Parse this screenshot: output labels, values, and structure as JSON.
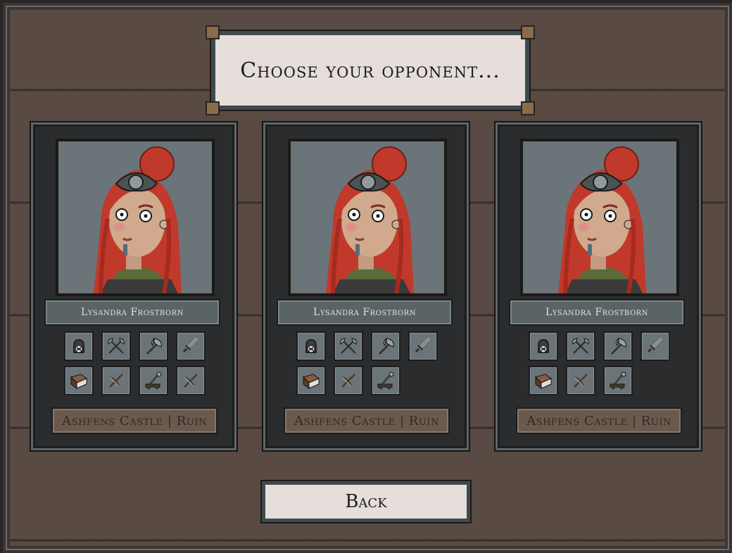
{
  "title": "Choose your opponent...",
  "opponents": [
    {
      "name": "Lysandra Frostborn",
      "location": "Ashfens Castle | Ruin",
      "items": [
        "bell-icon",
        "crossed-axes-icon",
        "battle-axe-icon",
        "sword-icon",
        "book-icon",
        "crossbow-icon",
        "catapult-icon",
        "crossbow-icon"
      ]
    },
    {
      "name": "Lysandra Frostborn",
      "location": "Ashfens Castle | Ruin",
      "items": [
        "bell-icon",
        "crossed-axes-icon",
        "battle-axe-icon",
        "sword-icon",
        "book-icon",
        "crossbow-icon",
        "catapult-icon"
      ]
    },
    {
      "name": "Lysandra Frostborn",
      "location": "Ashfens Castle | Ruin",
      "items": [
        "bell-icon",
        "crossed-axes-icon",
        "battle-axe-icon",
        "sword-icon",
        "book-icon",
        "crossbow-icon",
        "catapult-icon"
      ]
    }
  ],
  "back_label": "Back"
}
